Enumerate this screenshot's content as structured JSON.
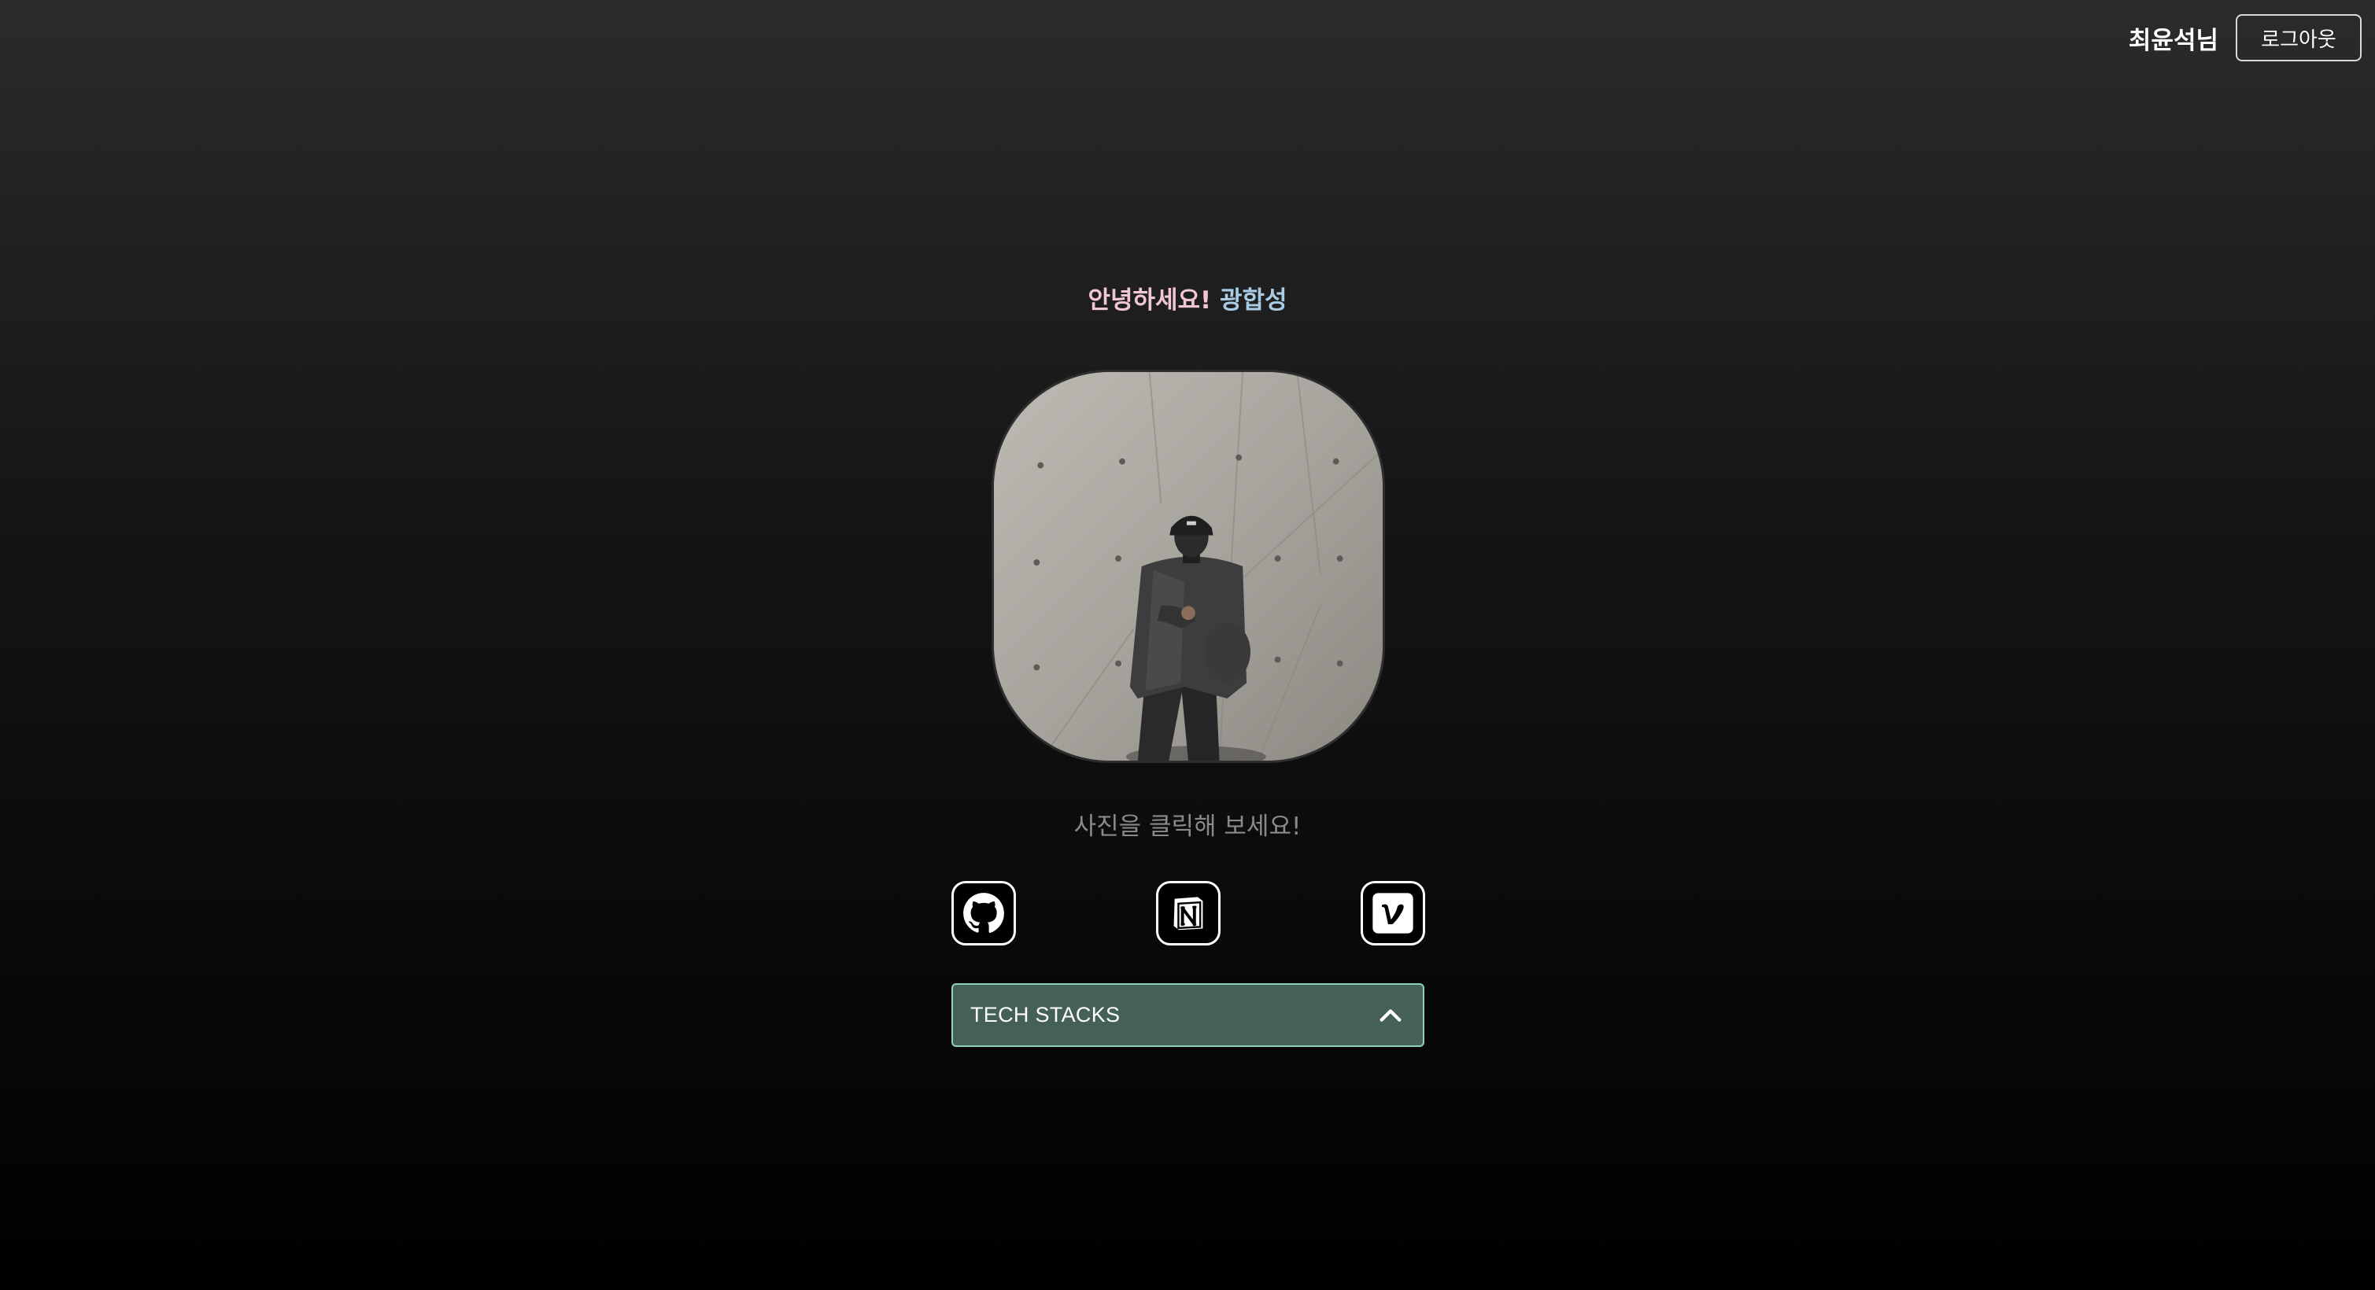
{
  "header": {
    "user_name": "최윤석님",
    "logout_label": "로그아웃"
  },
  "profile": {
    "greeting_hello": "안녕하세요!",
    "greeting_name": "광합성",
    "photo_hint": "사진을 클릭해 보세요!"
  },
  "social_links": [
    {
      "name": "github",
      "icon": "github-icon"
    },
    {
      "name": "notion",
      "icon": "notion-icon"
    },
    {
      "name": "velog",
      "icon": "velog-icon"
    }
  ],
  "accordion": {
    "label": "TECH STACKS",
    "state": "expanded-indicator",
    "icon": "chevron-up-icon"
  },
  "colors": {
    "greeting_hello": "#f0c6d4",
    "greeting_name": "#a9cbe4",
    "accordion_bg": "#456155",
    "accordion_border": "#8fd1bb"
  }
}
